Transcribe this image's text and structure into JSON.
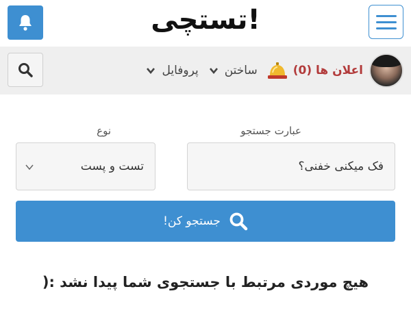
{
  "header": {
    "logo": "تستچی!",
    "bell_icon": "bell-icon",
    "menu_icon": "hamburger-icon",
    "accent_color": "#3e8fd1"
  },
  "navbar": {
    "profile": "پروفایل",
    "create": "ساختن",
    "alerts": "اعلان ها (0)",
    "search_icon": "search-icon",
    "alerts_icon": "service-bell-icon"
  },
  "search": {
    "query_label": "عبارت جستجو",
    "query_value": "فک میکنی خفنی؟",
    "type_label": "نوع",
    "type_value": "تست و پست",
    "submit_label": "جستجو کن!"
  },
  "result": {
    "empty_message": "هیچ موردی مرتبط با جستجوی شما پیدا نشد :("
  }
}
